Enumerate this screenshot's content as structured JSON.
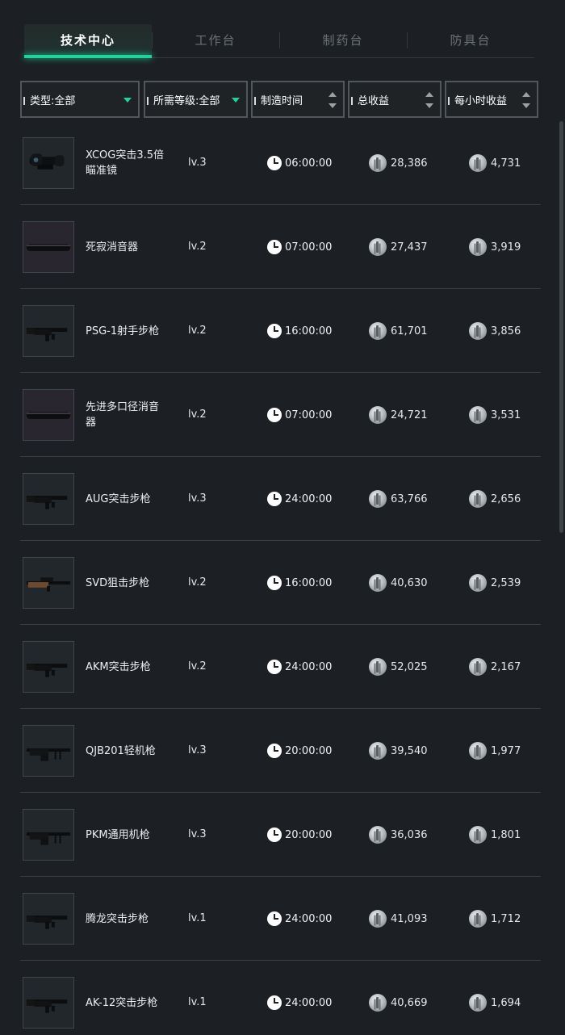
{
  "tabs": [
    {
      "label": "技术中心",
      "active": true
    },
    {
      "label": "工作台",
      "active": false
    },
    {
      "label": "制药台",
      "active": false
    },
    {
      "label": "防具台",
      "active": false
    }
  ],
  "filters": {
    "type_label": "类型:全部",
    "level_label": "所需等级:全部",
    "time_label": "制造时间",
    "total_label": "总收益",
    "hourly_label": "每小时收益"
  },
  "colors": {
    "accent": "#1fd49a",
    "background": "#1c2024"
  },
  "items": [
    {
      "name": "XCOG突击3.5倍瞄准镜",
      "level": "lv.3",
      "time": "06:00:00",
      "total": "28,386",
      "hourly": "4,731",
      "icon": "scope-icon"
    },
    {
      "name": "死寂消音器",
      "level": "lv.2",
      "time": "07:00:00",
      "total": "27,437",
      "hourly": "3,919",
      "icon": "suppressor-icon"
    },
    {
      "name": "PSG-1射手步枪",
      "level": "lv.2",
      "time": "16:00:00",
      "total": "61,701",
      "hourly": "3,856",
      "icon": "rifle-icon"
    },
    {
      "name": "先进多口径消音器",
      "level": "lv.2",
      "time": "07:00:00",
      "total": "24,721",
      "hourly": "3,531",
      "icon": "suppressor-icon"
    },
    {
      "name": "AUG突击步枪",
      "level": "lv.3",
      "time": "24:00:00",
      "total": "63,766",
      "hourly": "2,656",
      "icon": "rifle-icon"
    },
    {
      "name": "SVD狙击步枪",
      "level": "lv.2",
      "time": "16:00:00",
      "total": "40,630",
      "hourly": "2,539",
      "icon": "sniper-rifle-icon"
    },
    {
      "name": "AKM突击步枪",
      "level": "lv.2",
      "time": "24:00:00",
      "total": "52,025",
      "hourly": "2,167",
      "icon": "rifle-icon"
    },
    {
      "name": "QJB201轻机枪",
      "level": "lv.3",
      "time": "20:00:00",
      "total": "39,540",
      "hourly": "1,977",
      "icon": "machine-gun-icon"
    },
    {
      "name": "PKM通用机枪",
      "level": "lv.3",
      "time": "20:00:00",
      "total": "36,036",
      "hourly": "1,801",
      "icon": "machine-gun-icon"
    },
    {
      "name": "腾龙突击步枪",
      "level": "lv.1",
      "time": "24:00:00",
      "total": "41,093",
      "hourly": "1,712",
      "icon": "rifle-icon"
    },
    {
      "name": "AK-12突击步枪",
      "level": "lv.1",
      "time": "24:00:00",
      "total": "40,669",
      "hourly": "1,694",
      "icon": "rifle-icon"
    }
  ]
}
